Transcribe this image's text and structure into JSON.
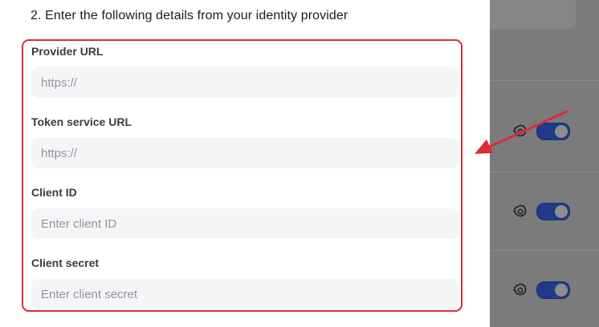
{
  "step": {
    "title": "2. Enter the following details from your identity provider"
  },
  "fields": [
    {
      "label": "Provider URL",
      "placeholder": "https://",
      "value": ""
    },
    {
      "label": "Token service URL",
      "placeholder": "https://",
      "value": ""
    },
    {
      "label": "Client ID",
      "placeholder": "Enter client ID",
      "value": ""
    },
    {
      "label": "Client secret",
      "placeholder": "Enter client secret",
      "value": ""
    }
  ],
  "background_rows": [
    {
      "icon": "gear-icon",
      "enabled": true
    },
    {
      "icon": "gear-icon",
      "enabled": true
    },
    {
      "icon": "gear-icon",
      "enabled": true
    }
  ],
  "colors": {
    "highlight": "#dc2b3b",
    "toggle_on": "#1f3a8a",
    "annotation_arrow": "#dc2b3b"
  }
}
